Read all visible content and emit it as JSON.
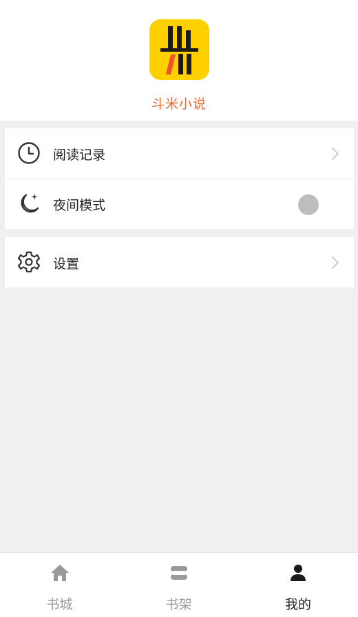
{
  "header": {
    "app_name": "斗米小说",
    "logo_icon": "bookshelf-logo",
    "logo_color": "#ffd000",
    "name_color": "#f0652a"
  },
  "menu": {
    "reading_history": {
      "label": "阅读记录",
      "icon": "clock-icon"
    },
    "night_mode": {
      "label": "夜间模式",
      "icon": "moon-icon",
      "enabled": false
    },
    "settings": {
      "label": "设置",
      "icon": "gear-icon"
    }
  },
  "tabbar": {
    "tabs": [
      {
        "label": "书城",
        "icon": "home-icon",
        "active": false
      },
      {
        "label": "书架",
        "icon": "bookshelf-icon",
        "active": false
      },
      {
        "label": "我的",
        "icon": "person-icon",
        "active": true
      }
    ]
  }
}
